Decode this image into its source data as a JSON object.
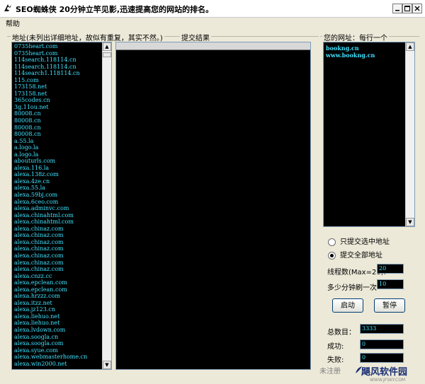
{
  "window": {
    "title": "SEO蜘蛛侠  20分钟立竿见影,迅速提高您的网站的排名。"
  },
  "menu": {
    "help": "帮助"
  },
  "address_group": {
    "label": "地址(未列出详细地址，故似有重复，其实不然。)",
    "items": [
      "0735heart.com",
      "0735heart.com",
      "114search.118114.cn",
      "114search.118114.cn",
      "114search1.118114.cn",
      "115.com",
      "173158.net",
      "173158.net",
      "365codes.cn",
      "3g.11ou.net",
      "80008.cn",
      "80008.cn",
      "80008.cn",
      "80008.cn",
      "a.55.la",
      "a.logo.la",
      "a.logo.la",
      "abouturls.com",
      "alexa.116.la",
      "alexa.138z.com",
      "alexa.4ze.cn",
      "alexa.55.la",
      "alexa.59bj.com",
      "alexa.6ceo.com",
      "alexa.adminvc.com",
      "alexa.chinahtml.com",
      "alexa.chinahtml.com",
      "alexa.chinaz.com",
      "alexa.chinaz.com",
      "alexa.chinaz.com",
      "alexa.chinaz.com",
      "alexa.chinaz.com",
      "alexa.chinaz.com",
      "alexa.chinaz.com",
      "alexa.cnzz.cc",
      "alexa.epclean.com",
      "alexa.epclean.com",
      "alexa.hrzzz.com",
      "alexa.itzz.net",
      "alexa.jz123.cn",
      "alexa.liehuo.net",
      "alexa.liehuo.net",
      "alexa.lvdown.com",
      "alexa.soogla.cn",
      "alexa.soogla.com",
      "alexa.syue.com",
      "alexa.webmasterhome.cn",
      "alexa.win2000.net"
    ]
  },
  "results_group": {
    "label": "提交结果"
  },
  "url_group": {
    "label": "您的网址：每行一个",
    "items": [
      "bookng.cn",
      "www.bookng.cn"
    ]
  },
  "options": {
    "radio_selected_label": "只提交选中地址",
    "radio_all_label": "提交全部地址",
    "selected": "all"
  },
  "settings": {
    "threads_label": "线程数(Max=20):",
    "threads_value": "20",
    "interval_label": "多少分钟刷一次",
    "interval_value": "10"
  },
  "buttons": {
    "start": "启动",
    "pause": "暂停"
  },
  "stats": {
    "total_label": "总数目：",
    "total_value": "3333",
    "success_label": "成功:",
    "success_value": "0",
    "fail_label": "失败:",
    "fail_value": "0"
  },
  "footer": {
    "unregistered": "未注册"
  },
  "watermark": {
    "text": "飓风软件园",
    "sub": "WWW.JFSKY.COM"
  }
}
